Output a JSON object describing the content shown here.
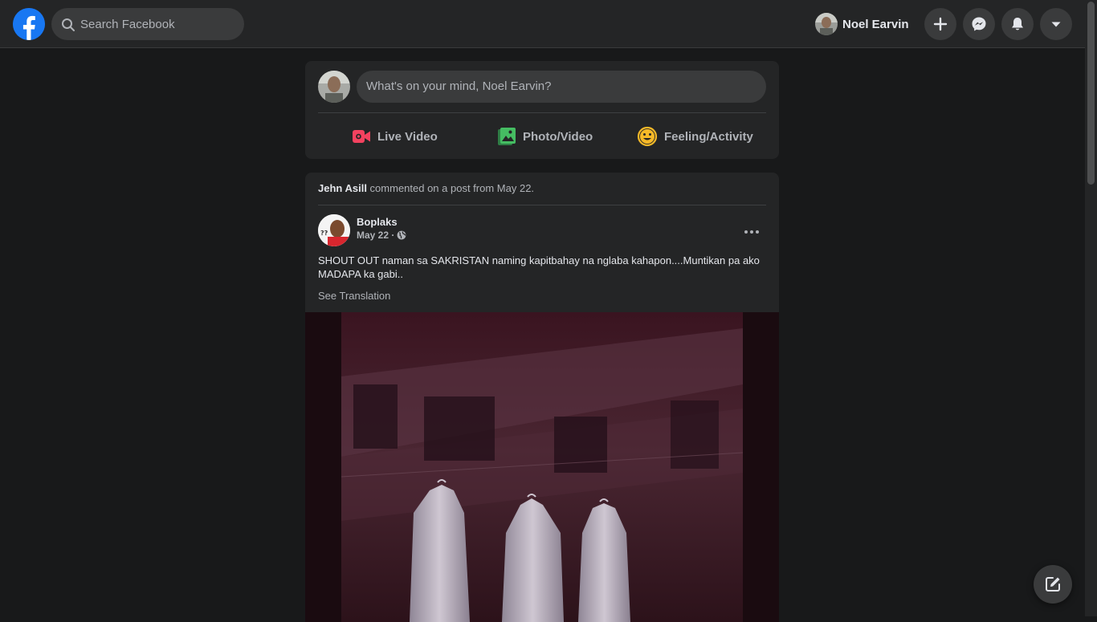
{
  "header": {
    "search_placeholder": "Search Facebook",
    "profile_name": "Noel Earvin"
  },
  "composer": {
    "prompt": "What's on your mind, Noel Earvin?",
    "actions": [
      {
        "label": "Live Video",
        "icon": "live-video-icon",
        "color": "#f3425f"
      },
      {
        "label": "Photo/Video",
        "icon": "photo-video-icon",
        "color": "#45bd62"
      },
      {
        "label": "Feeling/Activity",
        "icon": "feeling-icon",
        "color": "#f7b928"
      }
    ]
  },
  "post": {
    "activity_actor": "Jehn Asill",
    "activity_text": " commented on a post from May 22.",
    "author": "Boplaks",
    "date": "May 22 ·",
    "text": "SHOUT OUT naman sa SAKRISTAN naming kapitbahay na nglaba kahapon....Muntikan pa ako MADAPA ka gabi..",
    "see_translation": "See Translation"
  },
  "colors": {
    "brand": "#1877f2",
    "surface": "#242526",
    "background": "#18191a"
  }
}
